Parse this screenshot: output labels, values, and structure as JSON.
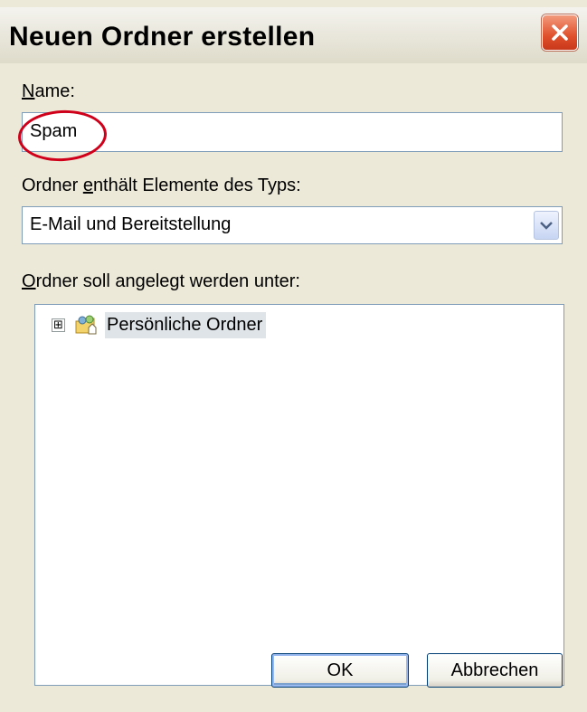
{
  "dialog": {
    "title": "Neuen Ordner erstellen",
    "close_icon": "close-icon"
  },
  "name_field": {
    "label_first": "N",
    "label_rest": "ame:",
    "value": "Spam"
  },
  "type_field": {
    "label_pre": "Ordner ",
    "label_accel": "e",
    "label_post": "nthält Elemente des Typs:",
    "selected": "E-Mail und Bereitstellung"
  },
  "location_field": {
    "label_first": "O",
    "label_rest": "rdner soll angelegt werden unter:",
    "tree": [
      {
        "label": "Persönliche Ordner",
        "expander": "⊞",
        "icon": "personal-folders-icon"
      }
    ]
  },
  "buttons": {
    "ok": "OK",
    "cancel": "Abbrechen"
  },
  "colors": {
    "dialog_bg": "#ECE9D8",
    "input_border": "#7F9DB9",
    "annotation_circle": "#D0001A",
    "close_button": "#E0502D"
  }
}
